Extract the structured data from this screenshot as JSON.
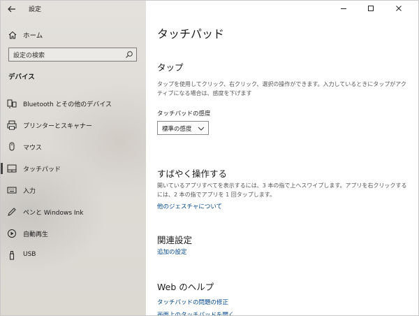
{
  "window": {
    "title": "設定"
  },
  "sidebar": {
    "home_label": "ホーム",
    "search_placeholder": "設定の検索",
    "section_label": "デバイス",
    "items": [
      {
        "label": "Bluetooth とその他のデバイス",
        "icon": "bluetooth-device-icon"
      },
      {
        "label": "プリンターとスキャナー",
        "icon": "printer-icon"
      },
      {
        "label": "マウス",
        "icon": "mouse-icon"
      },
      {
        "label": "タッチパッド",
        "icon": "touchpad-icon",
        "active": true
      },
      {
        "label": "入力",
        "icon": "keyboard-icon"
      },
      {
        "label": "ペンと Windows Ink",
        "icon": "pen-icon"
      },
      {
        "label": "自動再生",
        "icon": "autoplay-icon"
      },
      {
        "label": "USB",
        "icon": "usb-icon"
      }
    ]
  },
  "main": {
    "page_title": "タッチパッド",
    "tap": {
      "heading": "タップ",
      "description": "タップを使用してクリック、右クリック、選択の操作ができます。入力しているときにタップがアクティブになる場合は、感度を下げます",
      "sensitivity_label": "タッチパッドの感度",
      "sensitivity_value": "標準の感度"
    },
    "gestures": {
      "heading": "すばやく操作する",
      "description": "開いているアプリすべてを表示するには、3 本の指で上へスワイプします。アプリを右クリックするには、2 本の指でアプリを 1 回タップします。",
      "link": "他のジェスチャについて"
    },
    "related": {
      "heading": "関連設定",
      "link": "追加の設定"
    },
    "web_help": {
      "heading": "Web のヘルプ",
      "links": [
        "タッチパッドの問題の修正",
        "画面上のタッチパッドを開く"
      ]
    }
  },
  "colors": {
    "link": "#00468c",
    "active_indicator": "#444444"
  }
}
